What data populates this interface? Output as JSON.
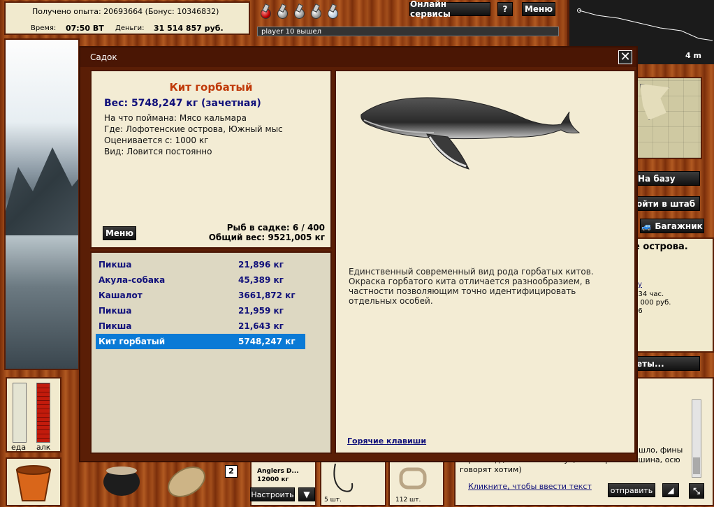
{
  "stats": {
    "experience": "Получено опыта: 20693664 (Бонус: 10346832)",
    "time_label": "Время:",
    "time_value": "07:50 ВТ",
    "money_label": "Деньги:",
    "money_value": "31 514 857 руб."
  },
  "header": {
    "online_services": "Онлайн сервисы",
    "help": "?",
    "menu": "Меню"
  },
  "chat_status": "player 10 вышел",
  "depth": "4 m",
  "right_buttons": {
    "to_base": "На базу",
    "go_hq": "ойти в штаб",
    "trunk": "🚙 Багажник",
    "more": "еты..."
  },
  "right_info": {
    "location": "е острова.",
    "link": "ку",
    "line1": ": 34 час.",
    "line2": "0 000 руб.",
    "line3": "26"
  },
  "meters": {
    "food": "еда",
    "alcohol": "алк"
  },
  "bottom": {
    "badge": "2",
    "lure_name": "Anglers D...",
    "lure_weight": "12000 кг",
    "configure": "Настроить",
    "hook_count": "5 шт.",
    "lure_count": "112 шт."
  },
  "chat": {
    "text_line1": "шло, фины",
    "text_line2": "горб и т.д., почти без белух, потом раз и тишина, осю",
    "text_line3": "говорят хотим)",
    "input_placeholder": "Кликните, чтобы ввести текст",
    "send": "отправить"
  },
  "dialog": {
    "title": "Садок",
    "close": "✕",
    "fish": {
      "name": "Кит горбатый",
      "weight": "Вес: 5748,247 кг (зачетная)",
      "caught_with": "На что поймана: Мясо кальмара",
      "where": "Где: Лофотенские острова, Южный мыс",
      "valued_from": "Оценивается с: 1000 кг",
      "kind": "Вид: Ловится постоянно"
    },
    "menu": "Меню",
    "fish_count": "Рыб в садке: 6 / 400",
    "total_weight": "Общий вес: 9521,005 кг",
    "list": [
      {
        "name": "Пикша",
        "weight": "21,896 кг"
      },
      {
        "name": "Акула-собака",
        "weight": "45,389 кг"
      },
      {
        "name": "Кашалот",
        "weight": "3661,872 кг"
      },
      {
        "name": "Пикша",
        "weight": "21,959 кг"
      },
      {
        "name": "Пикша",
        "weight": "21,643 кг"
      },
      {
        "name": "Кит горбатый",
        "weight": "5748,247 кг"
      }
    ],
    "description": "Единственный современный вид рода горбатых китов. Окраска горбатого кита отличается разнообразием, в частности позволяющим точно идентифицировать отдельных особей.",
    "hotkeys": "Горячие клавиши"
  }
}
